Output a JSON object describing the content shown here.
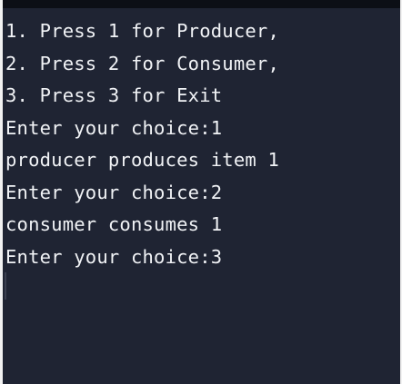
{
  "console": {
    "lines": [
      "1. Press 1 for Producer,",
      "2. Press 2 for Consumer,",
      "3. Press 3 for Exit",
      "Enter your choice:1",
      "producer produces item 1",
      "Enter your choice:2",
      "consumer consumes 1",
      "Enter your choice:3"
    ]
  },
  "colors": {
    "background": "#1f2433",
    "text": "#f1f3f6",
    "topbar": "#0c0f16"
  }
}
